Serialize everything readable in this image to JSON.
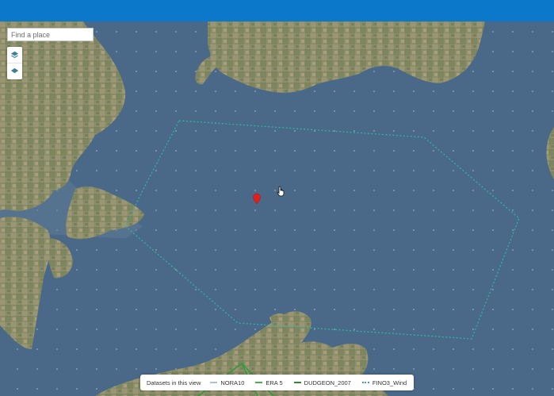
{
  "search": {
    "placeholder": "Find a place"
  },
  "controls": {
    "layers": [
      {
        "icon": "layers-icon"
      },
      {
        "icon": "layers-icon"
      }
    ]
  },
  "legend": {
    "title": "Datasets in this view",
    "items": [
      {
        "label": "NORA10",
        "color": "#a9c4d2"
      },
      {
        "label": "ERA 5",
        "color": "#4caf50"
      },
      {
        "label": "DUDGEON_2007",
        "color": "#2e8b2e"
      },
      {
        "label": "FINO3_Wind",
        "color": "#3aa89a"
      }
    ]
  },
  "colors": {
    "header": "#0b78c9",
    "sea": "#4a6888",
    "land": "#8e8f6c",
    "area_outline": "#2fb5a5",
    "marker": "#e11f1f",
    "region_lines": "#2f9a3a"
  },
  "marker": {
    "icon": "location-pin-icon"
  }
}
